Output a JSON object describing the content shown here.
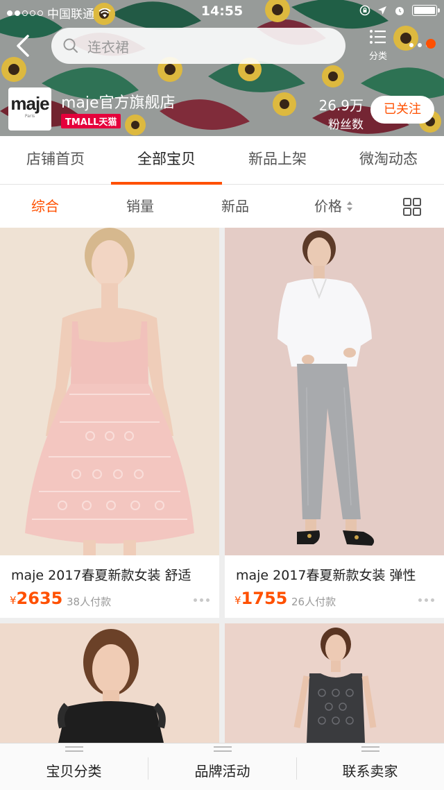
{
  "status_bar": {
    "carrier": "中国联通",
    "time": "14:55"
  },
  "header": {
    "search_placeholder": "连衣裙",
    "category_label": "分类",
    "shop_logo_text": "maje",
    "shop_logo_sub": "Paris",
    "shop_name": "maje官方旗舰店",
    "tmall_badge": "TMALL天猫",
    "fans_count": "26.9万",
    "fans_label": "粉丝数",
    "follow_label": "已关注"
  },
  "tabs": [
    {
      "label": "店铺首页"
    },
    {
      "label": "全部宝贝"
    },
    {
      "label": "新品上架"
    },
    {
      "label": "微淘动态"
    }
  ],
  "sort": [
    {
      "label": "综合"
    },
    {
      "label": "销量"
    },
    {
      "label": "新品"
    },
    {
      "label": "价格"
    }
  ],
  "products": [
    {
      "title": "maje 2017春夏新款女装 舒适",
      "currency": "¥",
      "price": "2635",
      "sold": "38人付款"
    },
    {
      "title": "maje 2017春夏新款女装 弹性",
      "currency": "¥",
      "price": "1755",
      "sold": "26人付款"
    },
    {
      "title": "",
      "currency": "",
      "price": "",
      "sold": ""
    },
    {
      "title": "",
      "currency": "",
      "price": "",
      "sold": ""
    }
  ],
  "bottom_bar": [
    {
      "label": "宝贝分类"
    },
    {
      "label": "品牌活动"
    },
    {
      "label": "联系卖家"
    }
  ],
  "colors": {
    "accent": "#ff5000",
    "tmall_red": "#e5003b"
  }
}
